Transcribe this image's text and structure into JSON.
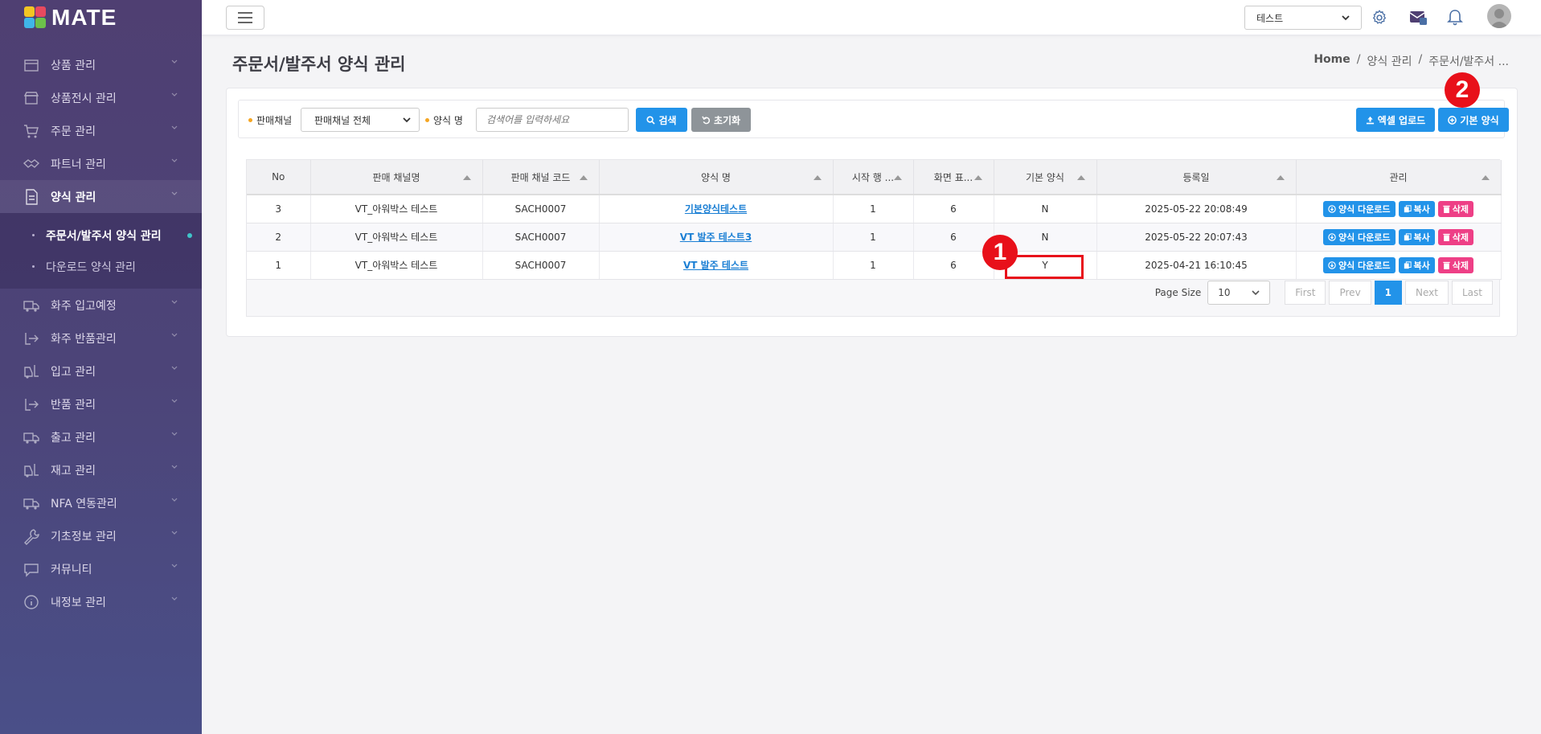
{
  "app": {
    "logo_text": "MATE"
  },
  "sidebar": {
    "items": [
      {
        "label": "상품 관리",
        "icon": "box-icon"
      },
      {
        "label": "상품전시 관리",
        "icon": "store-icon"
      },
      {
        "label": "주문 관리",
        "icon": "cart-icon"
      },
      {
        "label": "파트너 관리",
        "icon": "handshake-icon"
      },
      {
        "label": "양식 관리",
        "icon": "document-icon"
      }
    ],
    "submenu": [
      {
        "label": "주문서/발주서 양식 관리"
      },
      {
        "label": "다운로드 양식 관리"
      }
    ],
    "items_after": [
      {
        "label": "화주 입고예정",
        "icon": "truck-icon"
      },
      {
        "label": "화주 반품관리",
        "icon": "return-icon"
      },
      {
        "label": "입고 관리",
        "icon": "forklift-icon"
      },
      {
        "label": "반품 관리",
        "icon": "return-icon"
      },
      {
        "label": "출고 관리",
        "icon": "truck-icon"
      },
      {
        "label": "재고 관리",
        "icon": "forklift-icon"
      },
      {
        "label": "NFA 연동관리",
        "icon": "truck-icon"
      },
      {
        "label": "기초정보 관리",
        "icon": "wrench-icon"
      },
      {
        "label": "커뮤니티",
        "icon": "chat-icon"
      },
      {
        "label": "내정보 관리",
        "icon": "info-icon"
      }
    ]
  },
  "header": {
    "company_select": "테스트"
  },
  "page": {
    "title": "주문서/발주서 양식 관리",
    "breadcrumb": [
      "Home",
      "양식 관리",
      "주문서/발주서 ..."
    ],
    "breadcrumb_sep": "/"
  },
  "search": {
    "channel_label": "판매채널",
    "channel_value": "판매채널 전체",
    "form_label": "양식 명",
    "form_placeholder": "검색어를 입력하세요",
    "search_btn": "검색",
    "reset_btn": "초기화",
    "excel_btn": "엑셀 업로드",
    "default_btn": "기본 양식"
  },
  "table": {
    "columns": [
      "No",
      "판매 채널명",
      "판매 채널 코드",
      "양식 명",
      "시작 행 ...",
      "화면 표...",
      "기본 양식",
      "등록일",
      "관리"
    ],
    "rows": [
      {
        "no": "3",
        "channel": "VT_아워박스 테스트",
        "code": "SACH0007",
        "form": "기본양식테스트",
        "start": "1",
        "disp": "6",
        "default": "N",
        "date": "2025-05-22 20:08:49"
      },
      {
        "no": "2",
        "channel": "VT_아워박스 테스트",
        "code": "SACH0007",
        "form": "VT 발주 테스트3",
        "start": "1",
        "disp": "6",
        "default": "N",
        "date": "2025-05-22 20:07:43"
      },
      {
        "no": "1",
        "channel": "VT_아워박스 테스트",
        "code": "SACH0007",
        "form": "VT 발주 테스트",
        "start": "1",
        "disp": "6",
        "default": "Y",
        "date": "2025-04-21 16:10:45"
      }
    ],
    "actions": {
      "download": "양식 다운로드",
      "copy": "복사",
      "delete": "삭제"
    }
  },
  "pager": {
    "size_label": "Page Size",
    "size_value": "10",
    "first": "First",
    "prev": "Prev",
    "current": "1",
    "next": "Next",
    "last": "Last"
  },
  "annotations": {
    "marker1": "1",
    "marker2": "2"
  },
  "colors": {
    "accent": "#2293e9",
    "danger": "#ee3f86",
    "marker": "#e8101a",
    "sidebar": "#4c4478"
  }
}
